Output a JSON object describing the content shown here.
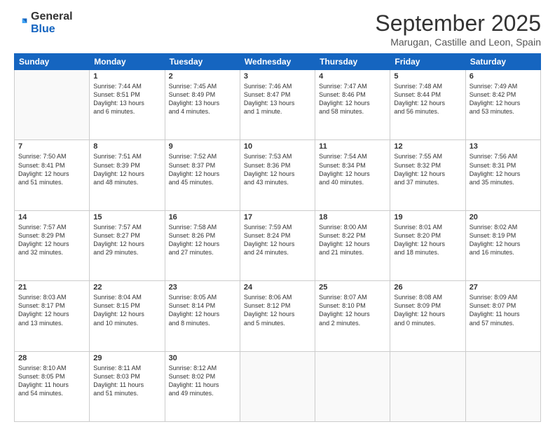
{
  "header": {
    "logo": {
      "general": "General",
      "blue": "Blue"
    },
    "title": "September 2025",
    "subtitle": "Marugan, Castille and Leon, Spain"
  },
  "calendar": {
    "weekdays": [
      "Sunday",
      "Monday",
      "Tuesday",
      "Wednesday",
      "Thursday",
      "Friday",
      "Saturday"
    ],
    "weeks": [
      [
        {
          "day": "",
          "info": ""
        },
        {
          "day": "1",
          "info": "Sunrise: 7:44 AM\nSunset: 8:51 PM\nDaylight: 13 hours\nand 6 minutes."
        },
        {
          "day": "2",
          "info": "Sunrise: 7:45 AM\nSunset: 8:49 PM\nDaylight: 13 hours\nand 4 minutes."
        },
        {
          "day": "3",
          "info": "Sunrise: 7:46 AM\nSunset: 8:47 PM\nDaylight: 13 hours\nand 1 minute."
        },
        {
          "day": "4",
          "info": "Sunrise: 7:47 AM\nSunset: 8:46 PM\nDaylight: 12 hours\nand 58 minutes."
        },
        {
          "day": "5",
          "info": "Sunrise: 7:48 AM\nSunset: 8:44 PM\nDaylight: 12 hours\nand 56 minutes."
        },
        {
          "day": "6",
          "info": "Sunrise: 7:49 AM\nSunset: 8:42 PM\nDaylight: 12 hours\nand 53 minutes."
        }
      ],
      [
        {
          "day": "7",
          "info": "Sunrise: 7:50 AM\nSunset: 8:41 PM\nDaylight: 12 hours\nand 51 minutes."
        },
        {
          "day": "8",
          "info": "Sunrise: 7:51 AM\nSunset: 8:39 PM\nDaylight: 12 hours\nand 48 minutes."
        },
        {
          "day": "9",
          "info": "Sunrise: 7:52 AM\nSunset: 8:37 PM\nDaylight: 12 hours\nand 45 minutes."
        },
        {
          "day": "10",
          "info": "Sunrise: 7:53 AM\nSunset: 8:36 PM\nDaylight: 12 hours\nand 43 minutes."
        },
        {
          "day": "11",
          "info": "Sunrise: 7:54 AM\nSunset: 8:34 PM\nDaylight: 12 hours\nand 40 minutes."
        },
        {
          "day": "12",
          "info": "Sunrise: 7:55 AM\nSunset: 8:32 PM\nDaylight: 12 hours\nand 37 minutes."
        },
        {
          "day": "13",
          "info": "Sunrise: 7:56 AM\nSunset: 8:31 PM\nDaylight: 12 hours\nand 35 minutes."
        }
      ],
      [
        {
          "day": "14",
          "info": "Sunrise: 7:57 AM\nSunset: 8:29 PM\nDaylight: 12 hours\nand 32 minutes."
        },
        {
          "day": "15",
          "info": "Sunrise: 7:57 AM\nSunset: 8:27 PM\nDaylight: 12 hours\nand 29 minutes."
        },
        {
          "day": "16",
          "info": "Sunrise: 7:58 AM\nSunset: 8:26 PM\nDaylight: 12 hours\nand 27 minutes."
        },
        {
          "day": "17",
          "info": "Sunrise: 7:59 AM\nSunset: 8:24 PM\nDaylight: 12 hours\nand 24 minutes."
        },
        {
          "day": "18",
          "info": "Sunrise: 8:00 AM\nSunset: 8:22 PM\nDaylight: 12 hours\nand 21 minutes."
        },
        {
          "day": "19",
          "info": "Sunrise: 8:01 AM\nSunset: 8:20 PM\nDaylight: 12 hours\nand 18 minutes."
        },
        {
          "day": "20",
          "info": "Sunrise: 8:02 AM\nSunset: 8:19 PM\nDaylight: 12 hours\nand 16 minutes."
        }
      ],
      [
        {
          "day": "21",
          "info": "Sunrise: 8:03 AM\nSunset: 8:17 PM\nDaylight: 12 hours\nand 13 minutes."
        },
        {
          "day": "22",
          "info": "Sunrise: 8:04 AM\nSunset: 8:15 PM\nDaylight: 12 hours\nand 10 minutes."
        },
        {
          "day": "23",
          "info": "Sunrise: 8:05 AM\nSunset: 8:14 PM\nDaylight: 12 hours\nand 8 minutes."
        },
        {
          "day": "24",
          "info": "Sunrise: 8:06 AM\nSunset: 8:12 PM\nDaylight: 12 hours\nand 5 minutes."
        },
        {
          "day": "25",
          "info": "Sunrise: 8:07 AM\nSunset: 8:10 PM\nDaylight: 12 hours\nand 2 minutes."
        },
        {
          "day": "26",
          "info": "Sunrise: 8:08 AM\nSunset: 8:09 PM\nDaylight: 12 hours\nand 0 minutes."
        },
        {
          "day": "27",
          "info": "Sunrise: 8:09 AM\nSunset: 8:07 PM\nDaylight: 11 hours\nand 57 minutes."
        }
      ],
      [
        {
          "day": "28",
          "info": "Sunrise: 8:10 AM\nSunset: 8:05 PM\nDaylight: 11 hours\nand 54 minutes."
        },
        {
          "day": "29",
          "info": "Sunrise: 8:11 AM\nSunset: 8:03 PM\nDaylight: 11 hours\nand 51 minutes."
        },
        {
          "day": "30",
          "info": "Sunrise: 8:12 AM\nSunset: 8:02 PM\nDaylight: 11 hours\nand 49 minutes."
        },
        {
          "day": "",
          "info": ""
        },
        {
          "day": "",
          "info": ""
        },
        {
          "day": "",
          "info": ""
        },
        {
          "day": "",
          "info": ""
        }
      ]
    ]
  }
}
